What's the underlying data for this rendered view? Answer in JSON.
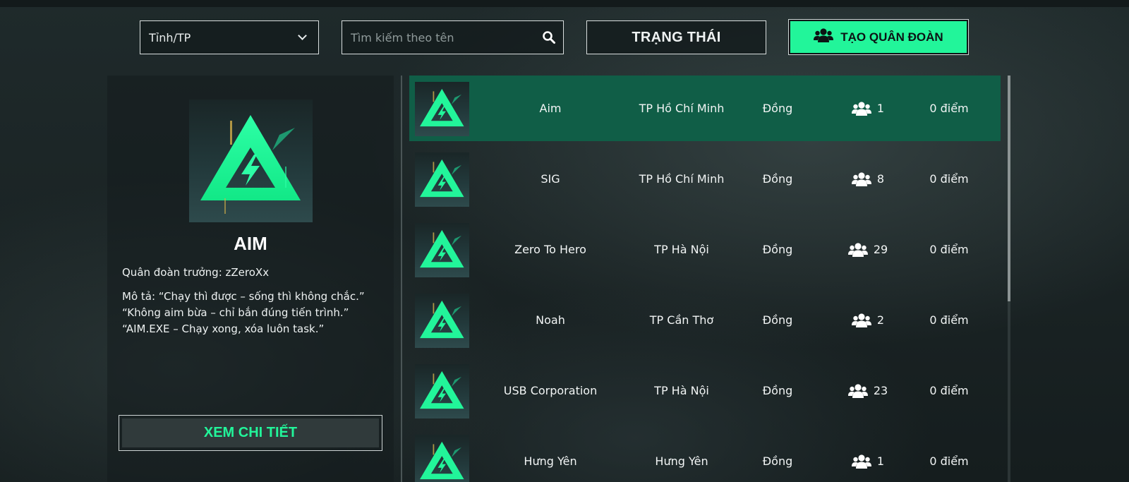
{
  "toolbar": {
    "province_select": "Tỉnh/TP",
    "search_placeholder": "Tìm kiếm theo tên",
    "status_label": "TRẠNG THÁI",
    "create_label": "TẠO QUÂN ĐOÀN"
  },
  "selected": {
    "name": "AIM",
    "leader": "Quân đoàn trưởng: zZeroXx",
    "description_lines": [
      "Mô tả: “Chạy thì được – sống thì không chắc.”",
      "“Không aim bừa – chỉ bắn đúng tiến trình.”",
      "“AIM.EXE – Chạy xong, xóa luôn task.”"
    ],
    "detail_label": "XEM CHI TIẾT"
  },
  "colors": {
    "accent": "#22f59a",
    "active_row": "#105e47"
  },
  "clans": [
    {
      "name": "Aim",
      "city": "TP Hồ Chí Minh",
      "rank": "Đồng",
      "members": "1",
      "points": "0 điểm",
      "active": true
    },
    {
      "name": "SIG",
      "city": "TP Hồ Chí Minh",
      "rank": "Đồng",
      "members": "8",
      "points": "0 điểm"
    },
    {
      "name": "Zero To Hero",
      "city": "TP Hà Nội",
      "rank": "Đồng",
      "members": "29",
      "points": "0 điểm"
    },
    {
      "name": "Noah",
      "city": "TP Cần Thơ",
      "rank": "Đồng",
      "members": "2",
      "points": "0 điểm"
    },
    {
      "name": "USB Corporation",
      "city": "TP Hà Nội",
      "rank": "Đồng",
      "members": "23",
      "points": "0 điểm"
    },
    {
      "name": "Hưng Yên",
      "city": "Hưng Yên",
      "rank": "Đồng",
      "members": "1",
      "points": "0 điểm"
    }
  ]
}
